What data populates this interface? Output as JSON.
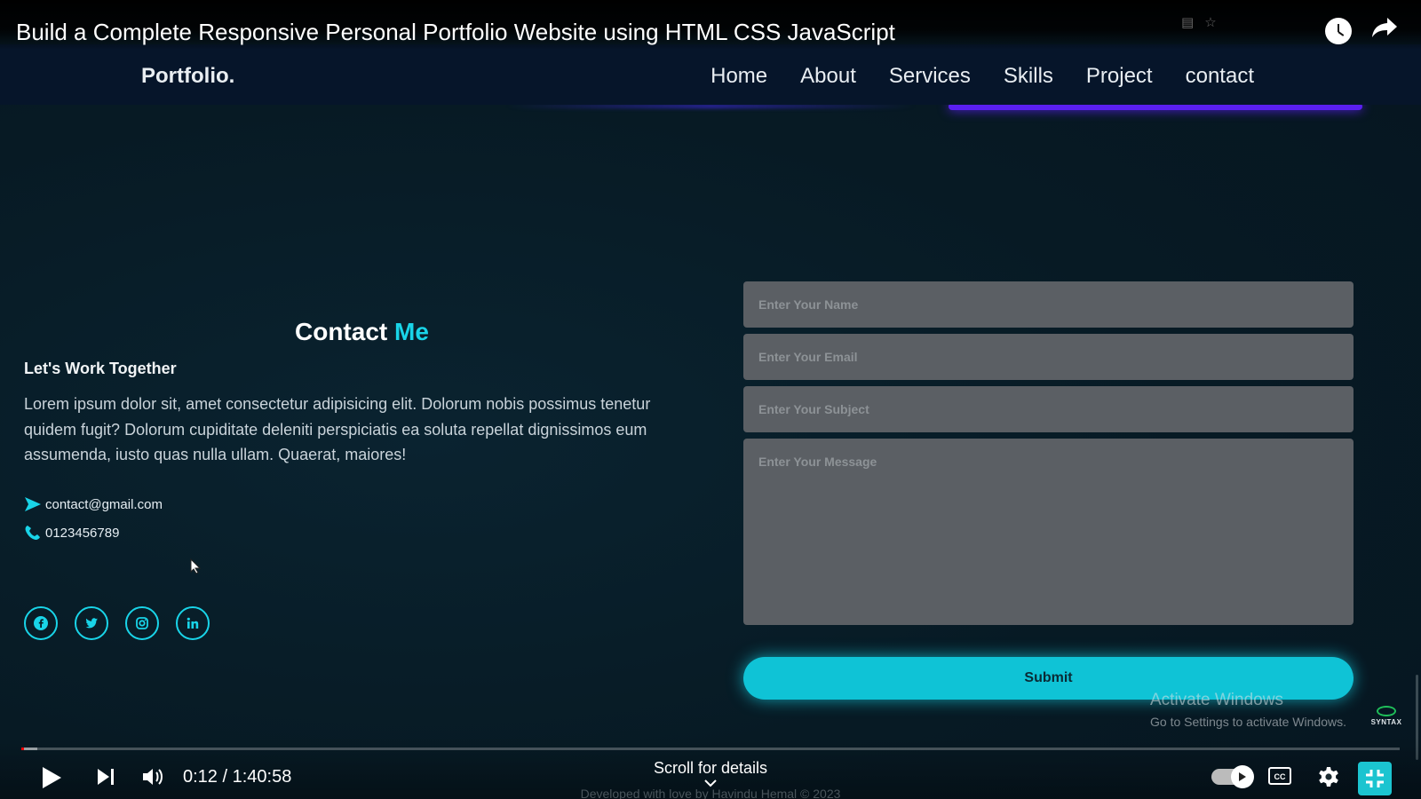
{
  "video": {
    "title": "Build a Complete Responsive Personal Portfolio Website using HTML CSS JavaScript"
  },
  "site": {
    "logo": "Portfolio.",
    "nav": [
      "Home",
      "About",
      "Services",
      "Skills",
      "Project",
      "contact"
    ]
  },
  "contact": {
    "heading_main": "Contact ",
    "heading_accent": "Me",
    "subheading": "Let's Work Together",
    "paragraph": "Lorem ipsum dolor sit, amet consectetur adipisicing elit. Dolorum nobis possimus tenetur quidem fugit? Dolorum cupiditate deleniti perspiciatis ea soluta repellat dignissimos eum assumenda, iusto quas nulla ullam. Quaerat, maiores!",
    "email": "contact@gmail.com",
    "phone": "0123456789",
    "socials": [
      "facebook-icon",
      "twitter-icon",
      "instagram-icon",
      "linkedin-icon"
    ]
  },
  "form": {
    "name_placeholder": "Enter Your Name",
    "email_placeholder": "Enter Your Email",
    "subject_placeholder": "Enter Your Subject",
    "message_placeholder": "Enter Your Message",
    "submit_label": "Submit"
  },
  "watermark": {
    "title": "Activate Windows",
    "subtitle": "Go to Settings to activate Windows.",
    "logo_text": "SYNTAX"
  },
  "player": {
    "time": "0:12 / 1:40:58",
    "progress_fraction": 0.002,
    "scroll_hint": "Scroll for details",
    "footer_credit": "Developed with love by Havindu Hemal © 2023"
  },
  "colors": {
    "accent": "#19d4e8",
    "nav_underline": "#5a1ff0",
    "progress": "#ff0000"
  }
}
